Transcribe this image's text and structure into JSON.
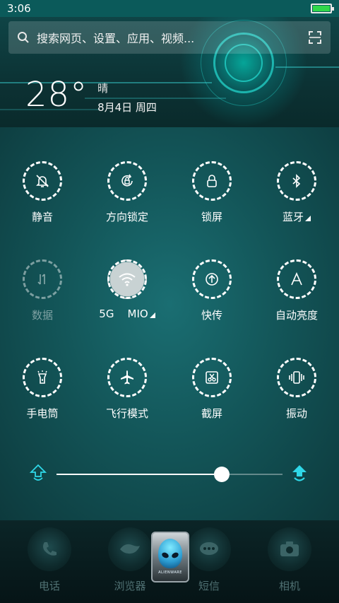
{
  "status_bar": {
    "time": "3:06",
    "battery_level": 1.0
  },
  "search": {
    "placeholder": "搜索网页、设置、应用、视频..."
  },
  "weather": {
    "temperature": "28°",
    "condition": "晴",
    "date": "8月4日 周四"
  },
  "toggles": [
    {
      "label": "静音",
      "icon": "bell-off-icon",
      "state": "on"
    },
    {
      "label": "方向锁定",
      "icon": "rotation-lock-icon",
      "state": "on"
    },
    {
      "label": "锁屏",
      "icon": "lock-icon",
      "state": "on"
    },
    {
      "label": "蓝牙",
      "icon": "bluetooth-icon",
      "state": "on",
      "has_menu": true
    },
    {
      "label": "数据",
      "icon": "data-arrows-icon",
      "state": "disabled"
    },
    {
      "label": "5G    MIO",
      "icon": "wifi-icon",
      "state": "active",
      "has_menu": true
    },
    {
      "label": "快传",
      "icon": "upload-icon",
      "state": "on"
    },
    {
      "label": "自动亮度",
      "icon": "letter-a-icon",
      "state": "on"
    },
    {
      "label": "手电筒",
      "icon": "flashlight-icon",
      "state": "on"
    },
    {
      "label": "飞行模式",
      "icon": "airplane-icon",
      "state": "on"
    },
    {
      "label": "截屏",
      "icon": "screenshot-scissors-icon",
      "state": "on"
    },
    {
      "label": "振动",
      "icon": "vibrate-icon",
      "state": "on"
    }
  ],
  "brightness": {
    "level": 0.73
  },
  "dock": [
    {
      "label": "电话",
      "icon": "phone-icon"
    },
    {
      "label": "浏览器",
      "icon": "browser-icon"
    },
    {
      "label": "短信",
      "icon": "message-icon"
    },
    {
      "label": "相机",
      "icon": "camera-icon"
    }
  ],
  "center_badge": {
    "text": "ALIENWARE",
    "icon": "alien-head-icon"
  },
  "colors": {
    "accent": "#2fd8e8",
    "panel": "#135659",
    "battery": "#2fd84a"
  }
}
